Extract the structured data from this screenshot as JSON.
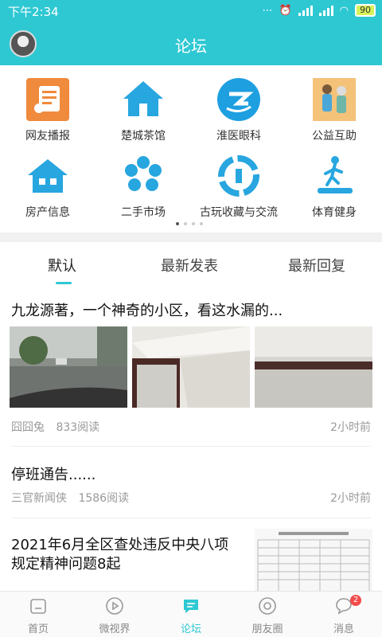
{
  "status_bar": {
    "time": "下午2:34",
    "battery": "90"
  },
  "header": {
    "title": "论坛"
  },
  "grid": {
    "items": [
      {
        "label": "网友播报",
        "icon": "broadcast-icon"
      },
      {
        "label": "楚城茶馆",
        "icon": "house-icon"
      },
      {
        "label": "淮医眼科",
        "icon": "eye-clinic-icon"
      },
      {
        "label": "公益互助",
        "icon": "charity-icon"
      },
      {
        "label": "房产信息",
        "icon": "real-estate-icon"
      },
      {
        "label": "二手市场",
        "icon": "market-icon"
      },
      {
        "label": "古玩收藏与交流",
        "icon": "antique-icon"
      },
      {
        "label": "体育健身",
        "icon": "fitness-icon"
      }
    ]
  },
  "tabs": [
    {
      "label": "默认"
    },
    {
      "label": "最新发表"
    },
    {
      "label": "最新回复"
    }
  ],
  "posts": [
    {
      "title": "九龙源著，一个神奇的小区，看这水漏的...",
      "author": "囧囧兔",
      "reads": "833阅读",
      "time": "2小时前"
    },
    {
      "title": "停班通告......",
      "author": "三官新闻侠",
      "reads": "1586阅读",
      "time": "2小时前"
    },
    {
      "title_line1": "2021年6月全区查处违反中央八项",
      "title_line2": "规定精神问题8起"
    }
  ],
  "bottom_nav": [
    {
      "label": "首页",
      "icon": "home-icon"
    },
    {
      "label": "微视界",
      "icon": "video-icon"
    },
    {
      "label": "论坛",
      "icon": "forum-icon"
    },
    {
      "label": "朋友圈",
      "icon": "friends-icon"
    },
    {
      "label": "消息",
      "icon": "message-icon",
      "badge": "2"
    }
  ],
  "colors": {
    "accent": "#2ec8d3",
    "badge": "#f24b4b"
  }
}
